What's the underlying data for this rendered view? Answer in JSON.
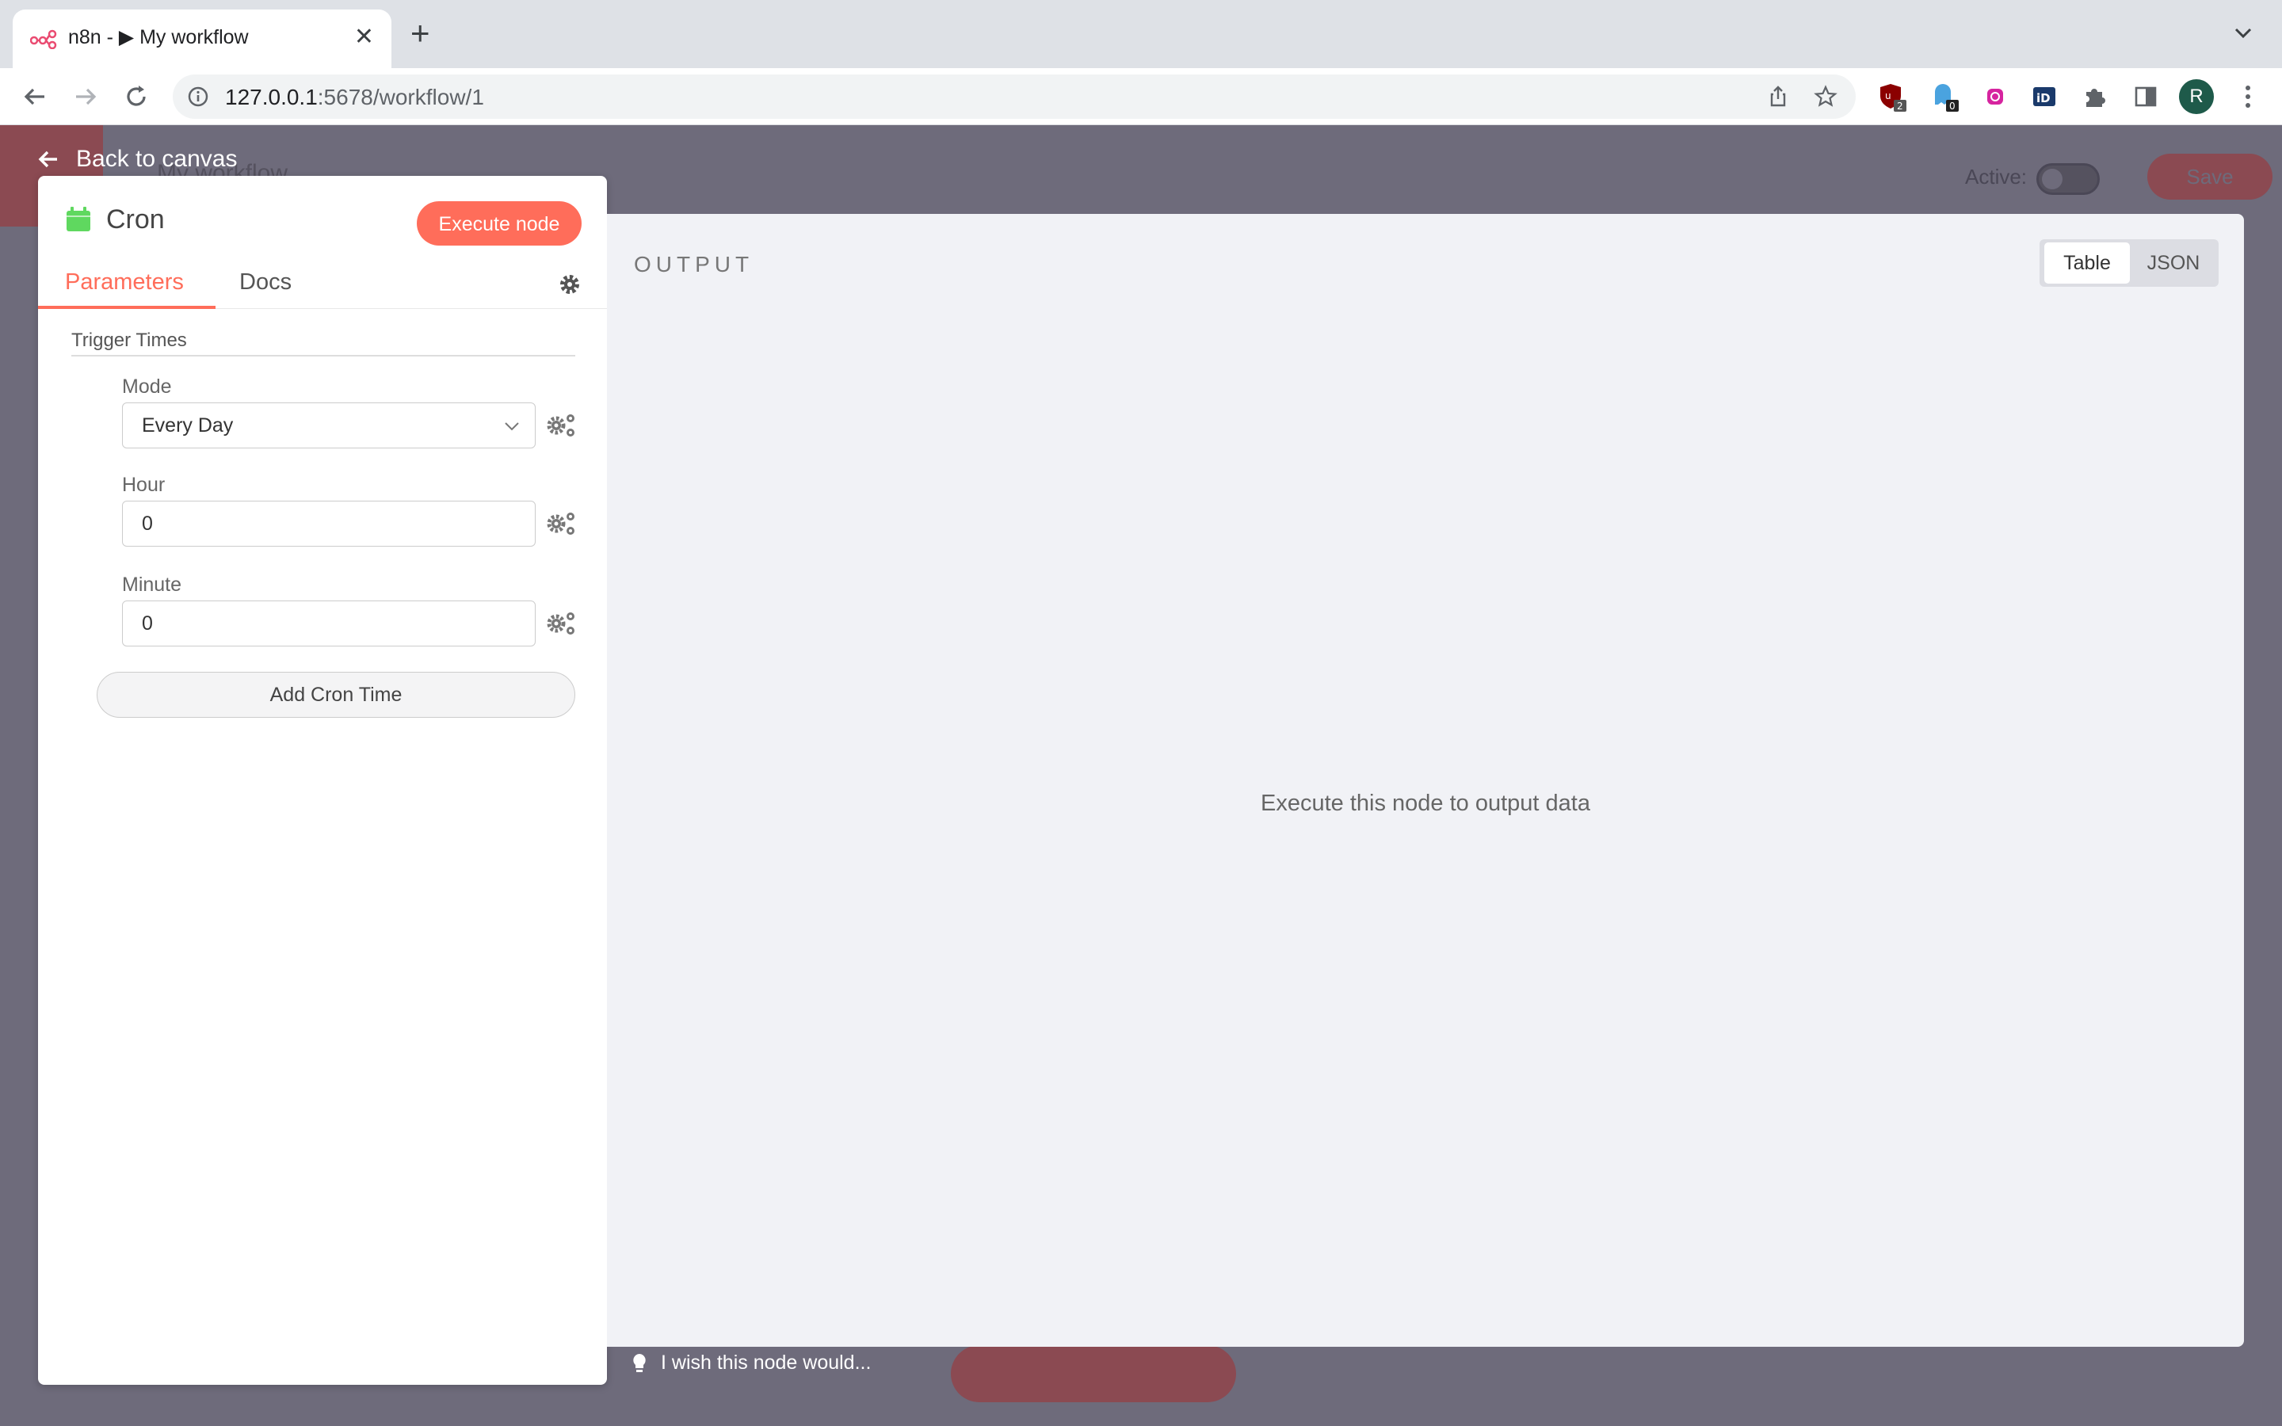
{
  "browser": {
    "tab_title": "n8n - ▶ My workflow",
    "new_tab_label": "+",
    "url_host": "127.0.0.1",
    "url_rest": ":5678/workflow/1",
    "extensions": [
      "ublock-icon",
      "ghostery-icon",
      "instagram-icon",
      "id-icon",
      "puzzle-icon",
      "sidepanel-icon"
    ],
    "ext_badges": {
      "ublock": "2",
      "ghostery": "0"
    },
    "profile_initial": "R"
  },
  "app": {
    "background_title": "My workflow",
    "active_label": "Active:",
    "save_label": "Save",
    "back_label": "Back to canvas"
  },
  "node": {
    "name": "Cron",
    "execute_label": "Execute node",
    "tabs": [
      {
        "label": "Parameters",
        "active": true
      },
      {
        "label": "Docs",
        "active": false
      }
    ],
    "section_title": "Trigger Times",
    "fields": [
      {
        "label": "Mode",
        "value": "Every Day",
        "type": "select"
      },
      {
        "label": "Hour",
        "value": "0",
        "type": "input"
      },
      {
        "label": "Minute",
        "value": "0",
        "type": "input"
      }
    ],
    "add_cron_label": "Add Cron Time"
  },
  "output": {
    "title": "OUTPUT",
    "view_options": [
      "Table",
      "JSON"
    ],
    "selected_view": "Table",
    "empty_message": "Execute this node to output data"
  },
  "feedback": {
    "wish_text": "I wish this node would..."
  },
  "colors": {
    "accent": "#ff6d5a",
    "cron_icon": "#5fd85f",
    "overlay": "#6e6b7b"
  }
}
